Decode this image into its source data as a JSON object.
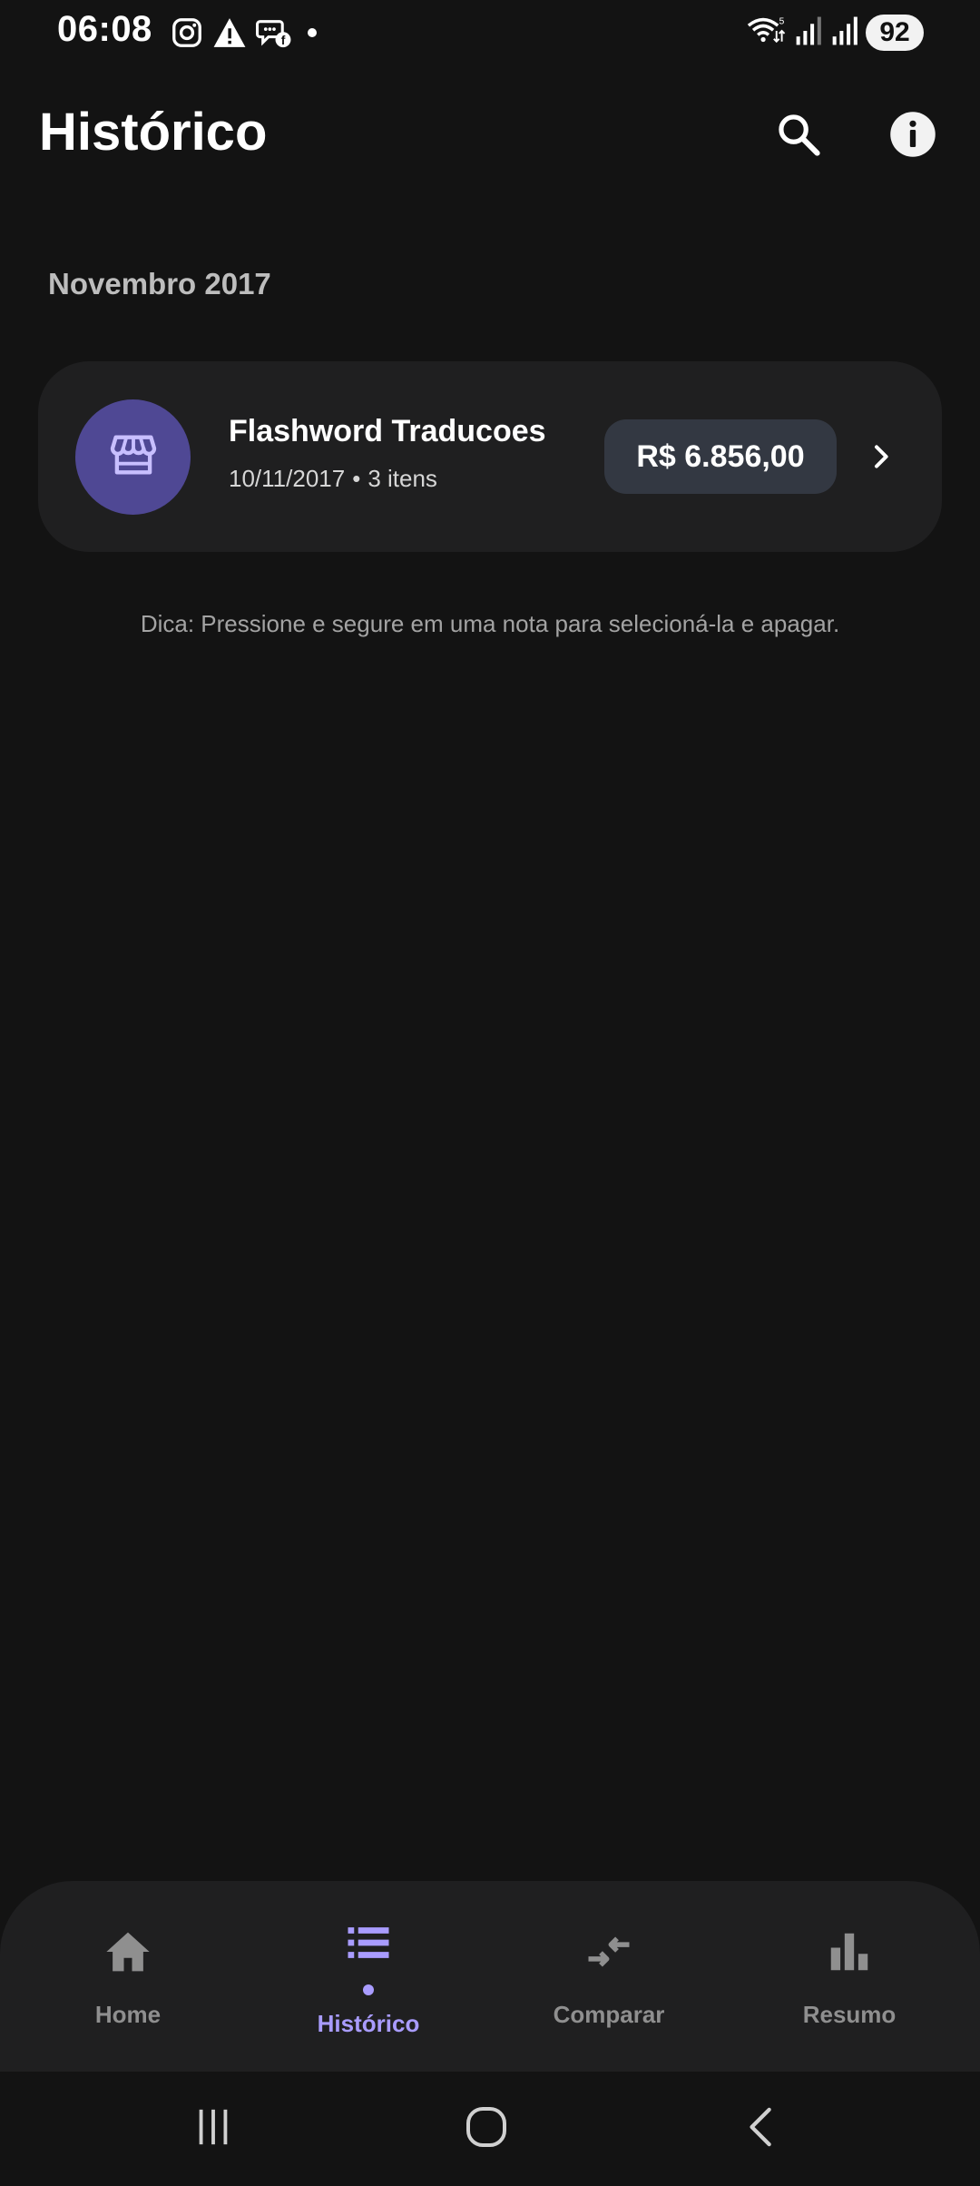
{
  "status_bar": {
    "time": "06:08",
    "battery": "92",
    "left_icons": [
      "instagram-icon",
      "warning-icon",
      "messenger-icon",
      "dot-icon"
    ],
    "right_icons": [
      "wifi-icon",
      "signal-icon",
      "signal-icon"
    ]
  },
  "header": {
    "title": "Histórico",
    "actions": [
      "search-icon",
      "info-icon"
    ]
  },
  "sections": [
    {
      "month": "Novembro 2017",
      "notes": [
        {
          "store": "Flashword Traducoes",
          "date": "10/11/2017",
          "separator": "•",
          "items": "3 itens",
          "amount": "R$ 6.856,00",
          "icon": "store-icon"
        }
      ]
    }
  ],
  "tip": "Dica: Pressione e segure em uma nota para selecioná-la e apagar.",
  "bottom_nav": {
    "items": [
      {
        "label": "Home",
        "icon": "home-icon",
        "active": false
      },
      {
        "label": "Histórico",
        "icon": "list-icon",
        "active": true
      },
      {
        "label": "Comparar",
        "icon": "compare-icon",
        "active": false
      },
      {
        "label": "Resumo",
        "icon": "bar-chart-icon",
        "active": false
      }
    ]
  },
  "colors": {
    "background": "#131313",
    "surface": "#1f1f20",
    "accent": "#a99cff",
    "avatar": "#4f4894",
    "amount_pill": "#333842",
    "inactive": "#8f8f8f"
  }
}
